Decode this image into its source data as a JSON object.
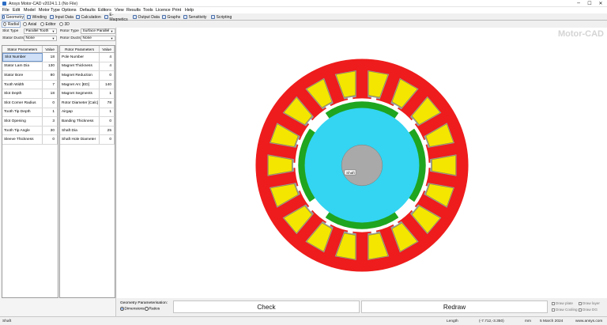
{
  "window": {
    "title": "Ansys Motor-CAD v2024.1.1 (No File)",
    "minimize": "─",
    "maximize": "☐",
    "close": "✕"
  },
  "menu": [
    "File",
    "Edit",
    "Model",
    "Motor Type",
    "Options",
    "Defaults",
    "Editors",
    "View",
    "Results",
    "Tools",
    "Licence",
    "Print",
    "Help"
  ],
  "main_tabs": [
    {
      "label": "Geometry",
      "icon": "geometry-icon",
      "active": true
    },
    {
      "label": "Winding",
      "icon": "winding-icon"
    },
    {
      "label": "Input Data",
      "icon": "input-data-icon"
    },
    {
      "label": "Calculation",
      "icon": "calculation-icon"
    },
    {
      "label": "E-Magnetics",
      "icon": "emagnetics-icon"
    },
    {
      "label": "Output Data",
      "icon": "output-data-icon"
    },
    {
      "label": "Graphs",
      "icon": "graphs-icon"
    },
    {
      "label": "Sensitivity",
      "icon": "sensitivity-icon"
    },
    {
      "label": "Scripting",
      "icon": "scripting-icon"
    }
  ],
  "sub_tabs": [
    {
      "label": "Radial",
      "active": true
    },
    {
      "label": "Axial"
    },
    {
      "label": "Editor"
    },
    {
      "label": "3D"
    }
  ],
  "selectors": {
    "slot_type_label": "Slot Type",
    "slot_type_value": "Parallel Tooth",
    "rotor_type_label": "Rotor Type",
    "rotor_type_value": "Surface Parallel",
    "stator_ducts_label": "Stator Ducts",
    "stator_ducts_value": "None",
    "rotor_ducts_label": "Rotor Ducts",
    "rotor_ducts_value": "None"
  },
  "stator_table": {
    "header_name": "Stator Parameters",
    "header_value": "Value",
    "rows": [
      {
        "name": "Slot Number",
        "value": "18"
      },
      {
        "name": "Stator Lam Dia",
        "value": "130"
      },
      {
        "name": "Stator Bore",
        "value": "80"
      },
      {
        "name": "Tooth Width",
        "value": "7"
      },
      {
        "name": "Slot Depth",
        "value": "18"
      },
      {
        "name": "Slot Corner Radius",
        "value": "0"
      },
      {
        "name": "Tooth Tip Depth",
        "value": "1"
      },
      {
        "name": "Slot Opening",
        "value": "3"
      },
      {
        "name": "Tooth Tip Angle",
        "value": "30"
      },
      {
        "name": "Sleeve Thickness",
        "value": "0"
      }
    ]
  },
  "rotor_table": {
    "header_name": "Rotor Parameters",
    "header_value": "Value",
    "rows": [
      {
        "name": "Pole Number",
        "value": "4"
      },
      {
        "name": "Magnet Thickness",
        "value": "4"
      },
      {
        "name": "Magnet Reduction",
        "value": "0"
      },
      {
        "name": "Magnet Arc [ED]",
        "value": "140"
      },
      {
        "name": "Magnet Segments",
        "value": "1"
      },
      {
        "name": "Rotor Diameter [Calc]",
        "value": "78"
      },
      {
        "name": "Airgap",
        "value": "1"
      },
      {
        "name": "Banding Thickness",
        "value": "0"
      },
      {
        "name": "Shaft Dia",
        "value": "25"
      },
      {
        "name": "Shaft Hole Diameter",
        "value": "0"
      }
    ]
  },
  "drawing": {
    "brand": "Motor-CAD",
    "shaft_label": "Shaft",
    "colors": {
      "stator": "#ee1c1c",
      "winding": "#f5e600",
      "liner": "#9a9a9a",
      "magnet": "#1fa51f",
      "rotor": "#33d5f2",
      "shaft": "#a9a9a9"
    }
  },
  "bottom": {
    "param_label": "Geometry Parameterisation:",
    "radio_dimensions": "Dimensions",
    "radio_ratios": "Ratios",
    "check_button": "Check",
    "redraw_button": "Redraw",
    "draw_plate": "Draw plate",
    "draw_cooling": "Draw Cooling",
    "draw_layer": "Draw layer",
    "draw_dg": "Draw DG"
  },
  "status": {
    "left": "Shaft",
    "length_label": "Length",
    "coords": "(-7.712,-3.350)",
    "units": "mm",
    "date": "5 March 2024",
    "site": "www.ansys.com"
  }
}
